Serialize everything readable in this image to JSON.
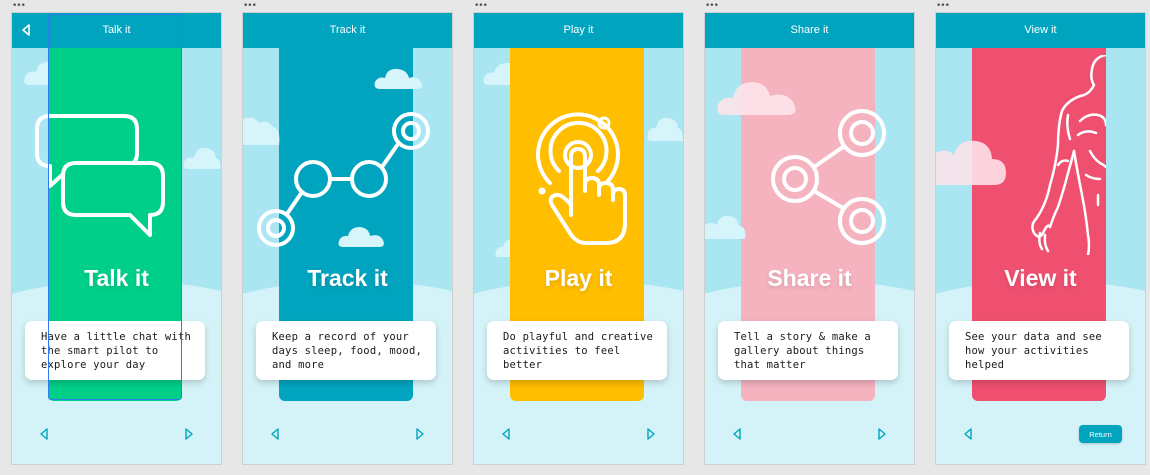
{
  "screens": [
    {
      "title": "Talk it",
      "heading": "Talk it",
      "description": "Have a little chat with the smart pilot to explore your day",
      "color": "#00cf8a",
      "icon": "chat-bubbles-icon"
    },
    {
      "title": "Track it",
      "heading": "Track it",
      "description": "Keep a record of your days sleep, food, mood, and more",
      "color": "#00a4bf",
      "icon": "connected-nodes-icon"
    },
    {
      "title": "Play it",
      "heading": "Play it",
      "description": "Do playful and creative activities to feel better",
      "color": "#ffbe00",
      "icon": "tap-finger-icon"
    },
    {
      "title": "Share it",
      "heading": "Share it",
      "description": "Tell a story & make a gallery about things that matter",
      "color": "#f5b3bf",
      "icon": "share-icon"
    },
    {
      "title": "View it",
      "heading": "View it",
      "description": "See your data and see how your activities helped",
      "color": "#f05070",
      "icon": "body-outline-icon"
    }
  ],
  "return_label": "Return",
  "colors": {
    "header": "#00a4bf",
    "sky": "#a9e6f2",
    "ground": "#d4f3f8",
    "selection": "#2b7de9"
  }
}
